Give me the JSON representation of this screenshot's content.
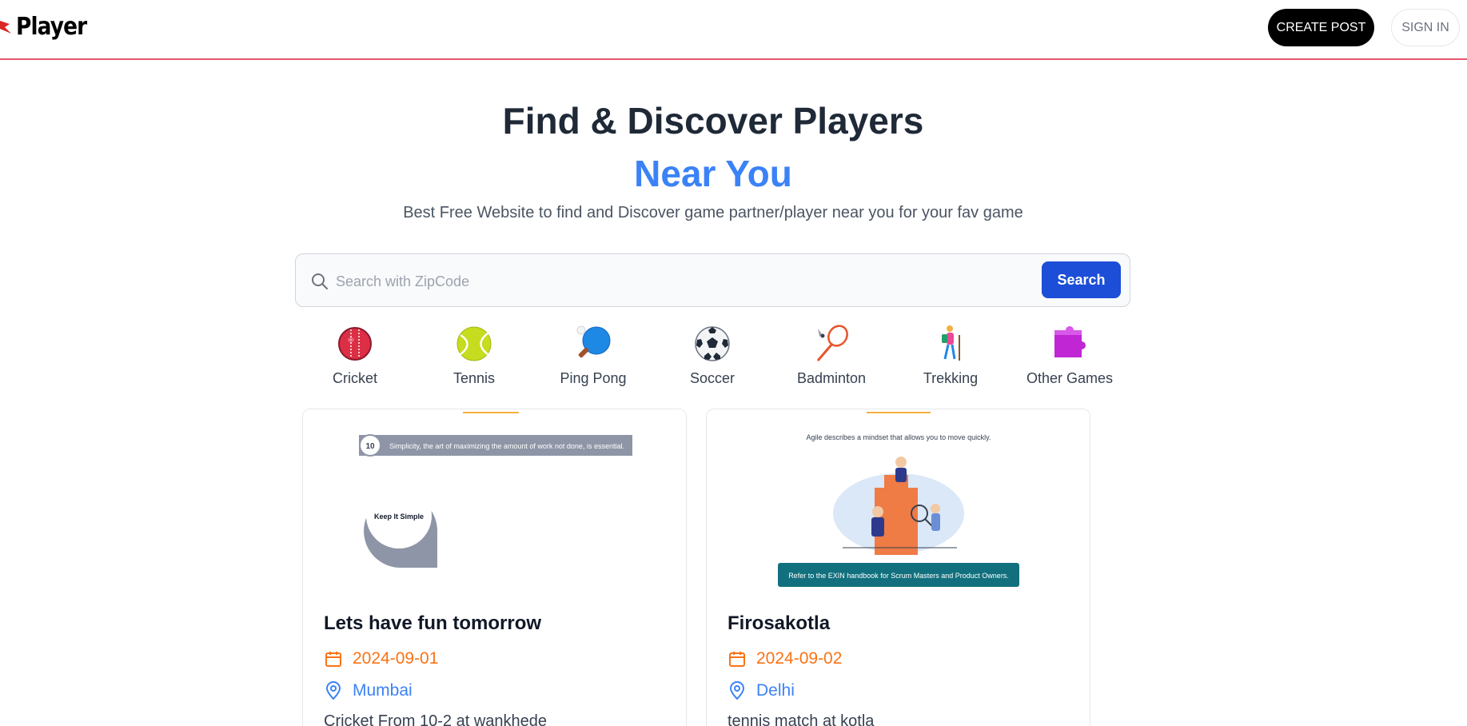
{
  "header": {
    "logo_text": "Player",
    "create_post_label": "CREATE POST",
    "sign_in_label": "SIGN IN"
  },
  "hero": {
    "title": "Find & Discover Players",
    "accent": "Near You",
    "subtitle": "Best Free Website to find and Discover game partner/player near you for your fav game"
  },
  "search": {
    "placeholder": "Search with ZipCode",
    "value": "",
    "button_label": "Search"
  },
  "categories": [
    {
      "label": "Cricket",
      "icon": "cricket-ball-icon"
    },
    {
      "label": "Tennis",
      "icon": "tennis-ball-icon"
    },
    {
      "label": "Ping Pong",
      "icon": "ping-pong-icon"
    },
    {
      "label": "Soccer",
      "icon": "soccer-ball-icon"
    },
    {
      "label": "Badminton",
      "icon": "badminton-icon"
    },
    {
      "label": "Trekking",
      "icon": "trekking-icon"
    },
    {
      "label": "Other Games",
      "icon": "puzzle-icon"
    }
  ],
  "posts": [
    {
      "title": "Lets have fun tomorrow",
      "date": "2024-09-01",
      "location": "Mumbai",
      "description": "Cricket From 10-2 at wankhede",
      "image": {
        "number": "10",
        "banner_text": "Simplicity, the art of maximizing the amount of work not done, is essential.",
        "circle_text": "Keep It Simple"
      }
    },
    {
      "title": "Firosakotla",
      "date": "2024-09-02",
      "location": "Delhi",
      "description": "tennis match at kotla",
      "image": {
        "caption": "Agile describes a mindset that allows you to move quickly.",
        "button_text": "Refer to the EXIN handbook for Scrum Masters and Product Owners."
      }
    }
  ],
  "colors": {
    "accent_blue": "#3b82f6",
    "search_button": "#1d4ed8",
    "date_orange": "#f97316",
    "header_border": "#e5566f"
  }
}
